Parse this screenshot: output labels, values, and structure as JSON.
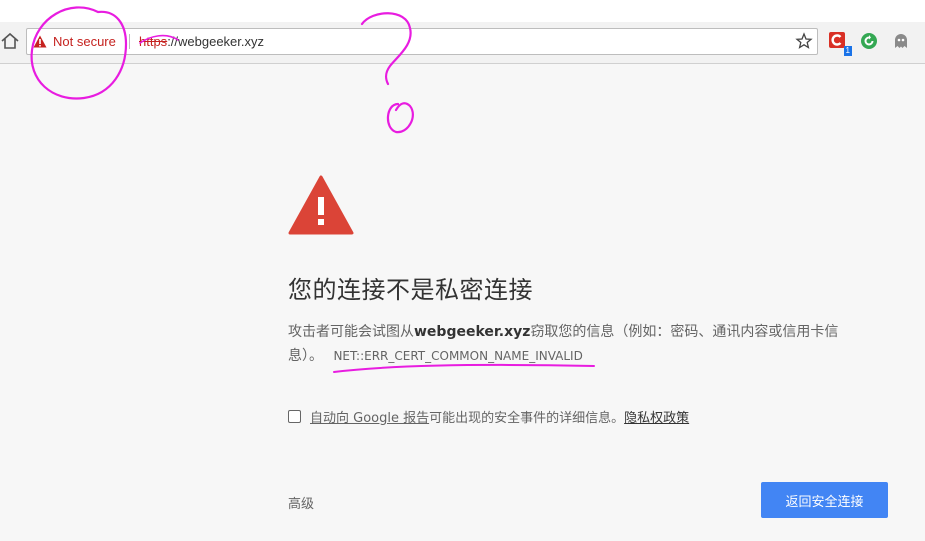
{
  "browser": {
    "security_label": "Not secure",
    "url_scheme": "https",
    "url_rest": "://webgeeker.xyz",
    "extension_badge": "1"
  },
  "interstitial": {
    "heading": "您的连接不是私密连接",
    "explanation_prefix": "攻击者可能会试图从",
    "explanation_host": "webgeeker.xyz",
    "explanation_suffix": "窃取您的信息（例如：密码、通讯内容或信用卡信息）。",
    "error_code": "NET::ERR_CERT_COMMON_NAME_INVALID",
    "report_link": "自动向 Google 报告",
    "report_text": "可能出现的安全事件的详细信息。",
    "privacy_link": "隐私权政策",
    "advanced_label": "高级",
    "back_button_label": "返回安全连接"
  },
  "colors": {
    "insecure_red": "#c5221f",
    "warning_red": "#db4437",
    "primary_blue": "#4285f4",
    "annotation_magenta": "#e81ce0"
  },
  "icons": [
    "home-icon",
    "warning-triangle-icon",
    "star-icon",
    "extension-c-icon",
    "extension-green-refresh-icon",
    "extension-ghost-icon"
  ]
}
